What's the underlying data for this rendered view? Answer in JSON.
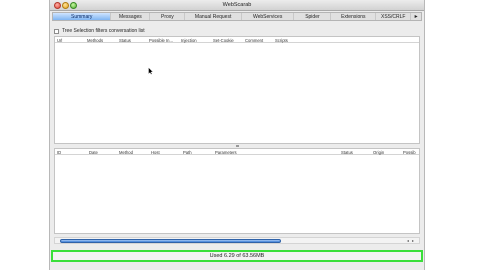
{
  "window": {
    "title": "WebScarab"
  },
  "tabs": [
    {
      "label": "Summary",
      "active": true,
      "width": 60
    },
    {
      "label": "Messages",
      "active": false,
      "width": 40
    },
    {
      "label": "Proxy",
      "active": false,
      "width": 36
    },
    {
      "label": "Manual Request",
      "active": false,
      "width": 58
    },
    {
      "label": "WebServices",
      "active": false,
      "width": 54
    },
    {
      "label": "Spider",
      "active": false,
      "width": 38
    },
    {
      "label": "Extensions",
      "active": false,
      "width": 46
    },
    {
      "label": "XSS/CRLF",
      "active": false,
      "width": 36
    }
  ],
  "filter": {
    "label": "Tree Selection filters conversation list",
    "checked": false
  },
  "top_table": {
    "columns": [
      "Url",
      "Methods",
      "Status",
      "Possible In...",
      "Injection",
      "Set-Cookie",
      "Comment",
      "Scripts"
    ]
  },
  "bottom_table": {
    "columns": [
      "ID",
      "Date",
      "Method",
      "Host",
      "Path",
      "Parameters",
      "Status",
      "Origin",
      "Possib"
    ]
  },
  "status": {
    "memory": "Used 6.29 of 63.56MB"
  },
  "colors": {
    "accent": "#7fb5f2",
    "status_border": "#3adf3a",
    "scroll_thumb": "#3d7fd6"
  },
  "icons": {
    "tab_more": "chevron-right-icon",
    "cursor": "mouse-pointer-icon"
  }
}
